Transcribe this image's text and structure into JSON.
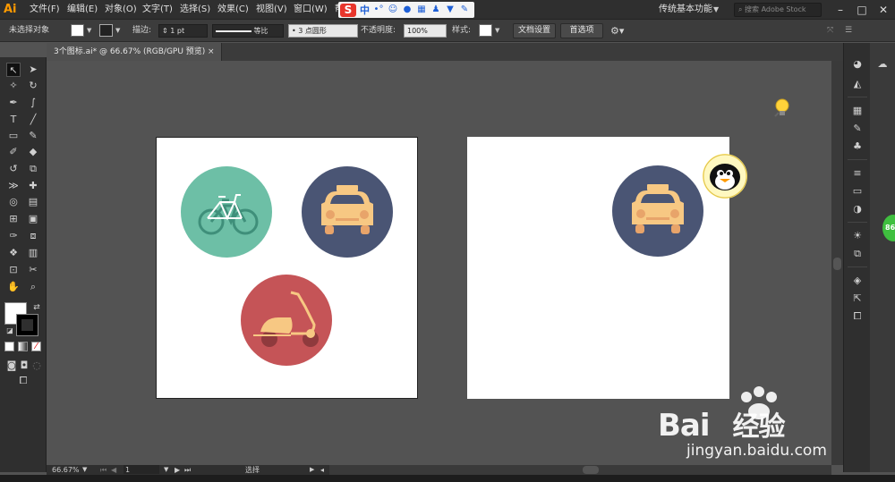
{
  "app": {
    "logo": "Ai"
  },
  "menus": [
    "文件(F)",
    "编辑(E)",
    "对象(O)",
    "文字(T)",
    "选择(S)",
    "效果(C)",
    "视图(V)",
    "窗口(W)",
    "帮"
  ],
  "ime": {
    "brand": "S",
    "mode": "中"
  },
  "workspace": {
    "label": "传统基本功能"
  },
  "stock_search": {
    "placeholder": "搜索 Adobe Stock"
  },
  "control_bar": {
    "selection_status": "未选择对象",
    "stroke_label": "描边:",
    "stroke_weight": "1 pt",
    "profile": "等比",
    "brush": "3 点圆形",
    "opacity_label": "不透明度:",
    "opacity_value": "100%",
    "style_label": "样式:",
    "doc_setup_button": "文档设置",
    "preferences_button": "首选项"
  },
  "document_tab": {
    "title": "3个图标.ai* @ 66.67% (RGB/GPU 预览)",
    "close": "×"
  },
  "status_bar": {
    "zoom": "66.67%",
    "artboard_number": "1",
    "tool_status": "选择"
  },
  "colors": {
    "teal_circle": "#6dbfa6",
    "navy_circle": "#4a5574",
    "red_circle": "#c55457",
    "taxi_body": "#f7c883",
    "taxi_wheel": "#e8a46a",
    "ui_dark": "#2f2f2f",
    "canvas_bg": "#535353"
  },
  "overlays": {
    "green_badge": "86",
    "watermark_brand": "Bai",
    "watermark_cn": "经验",
    "watermark_url": "jingyan.baidu.com"
  }
}
